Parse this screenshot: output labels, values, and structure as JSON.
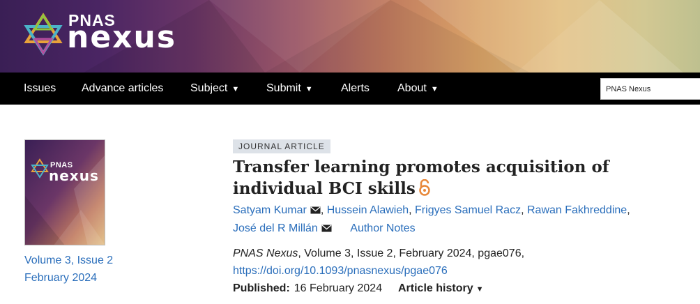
{
  "brand": {
    "pnas": "PNAS",
    "nexus": "nexus",
    "colors": {
      "banner_start": "#3a1f55",
      "banner_end": "#b9bb86",
      "link": "#2a6ebb",
      "nav_bg": "#000000",
      "tag_bg": "#dde2e8",
      "open_access": "#e8883a"
    }
  },
  "nav": {
    "items": [
      {
        "label": "Issues"
      },
      {
        "label": "Advance articles"
      },
      {
        "label": "Subject",
        "dropdown": true
      },
      {
        "label": "Submit",
        "dropdown": true
      },
      {
        "label": "Alerts"
      },
      {
        "label": "About",
        "dropdown": true
      }
    ],
    "caret": "▼"
  },
  "search": {
    "value": "PNAS Nexus"
  },
  "issue": {
    "volume": "Volume 3, Issue 2",
    "date": "February 2024"
  },
  "article": {
    "type": "JOURNAL ARTICLE",
    "title_line1": "Transfer learning promotes acquisition of",
    "title_line2": "individual BCI skills",
    "open_access_icon": "open-lock-icon",
    "authors": [
      {
        "name": "Satyam Kumar",
        "corresponding": true,
        "sep": ","
      },
      {
        "name": "Hussein Alawieh",
        "corresponding": false,
        "sep": ","
      },
      {
        "name": "Frigyes Samuel Racz",
        "corresponding": false,
        "sep": ","
      },
      {
        "name": "Rawan Fakhreddine",
        "corresponding": false,
        "sep": ","
      },
      {
        "name": "José del R Millán",
        "corresponding": true,
        "sep": ""
      }
    ],
    "author_notes": "Author Notes",
    "citation_journal": "PNAS Nexus",
    "citation_rest": ", Volume 3, Issue 2, February 2024, pgae076,",
    "doi": "https://doi.org/10.1093/pnasnexus/pgae076",
    "published_label": "Published:",
    "published_date": "16 February 2024",
    "history_label": "Article history",
    "history_caret": "▼"
  }
}
